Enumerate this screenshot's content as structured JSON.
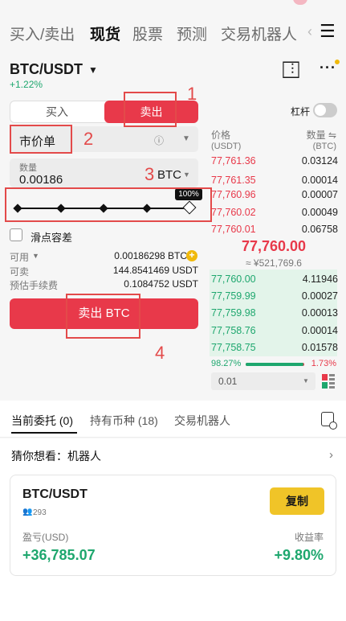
{
  "nav": {
    "tabs": [
      "买入/卖出",
      "现货",
      "股票",
      "预测",
      "交易机器人"
    ],
    "active_index": 1
  },
  "pair": {
    "symbol": "BTC/USDT",
    "change": "+1.22%"
  },
  "order": {
    "buy_label": "买入",
    "sell_label": "卖出",
    "leverage_label": "杠杆",
    "type": "市价单",
    "qty_label": "数量",
    "qty_value": "0.00186",
    "qty_unit": "BTC",
    "slider_pct": "100%",
    "slider_value": 1.0,
    "slippage_label": "滑点容差",
    "available_label": "可用",
    "available_value": "0.00186298 BTC",
    "sellable_label": "可卖",
    "sellable_value": "144.8541469 USDT",
    "fee_label": "预估手续费",
    "fee_value": "0.1084752 USDT",
    "submit_label": "卖出 BTC"
  },
  "orderbook": {
    "price_header": "价格",
    "price_unit": "(USDT)",
    "qty_header": "数量 ⇋",
    "qty_unit": "(BTC)",
    "asks": [
      {
        "price": "77,761.36",
        "qty": "0.03124"
      },
      {
        "price": "77,761.35",
        "qty": "0.00014"
      },
      {
        "price": "77,760.96",
        "qty": "0.00007"
      },
      {
        "price": "77,760.02",
        "qty": "0.00049"
      },
      {
        "price": "77,760.01",
        "qty": "0.06758"
      }
    ],
    "last_price": "77,760.00",
    "last_price_cny": "≈ ¥521,769.6",
    "bids": [
      {
        "price": "77,760.00",
        "qty": "4.11946"
      },
      {
        "price": "77,759.99",
        "qty": "0.00027"
      },
      {
        "price": "77,759.98",
        "qty": "0.00013"
      },
      {
        "price": "77,758.76",
        "qty": "0.00014"
      },
      {
        "price": "77,758.75",
        "qty": "0.01578"
      }
    ],
    "bid_pct": "98.27%",
    "ask_pct": "1.73%",
    "precision": "0.01"
  },
  "bottom_tabs": [
    {
      "label": "当前委托",
      "count": "(0)"
    },
    {
      "label": "持有币种",
      "count": "(18)"
    },
    {
      "label": "交易机器人",
      "count": ""
    }
  ],
  "suggest": {
    "title": "猜你想看：机器人"
  },
  "card": {
    "symbol": "BTC/USDT",
    "users": "293",
    "copy_label": "复制",
    "pnl_label": "盈亏(USD)",
    "pnl_value": "+36,785.07",
    "rate_label": "收益率",
    "rate_value": "+9.80%"
  },
  "annotations": [
    "1",
    "2",
    "3",
    "4"
  ]
}
